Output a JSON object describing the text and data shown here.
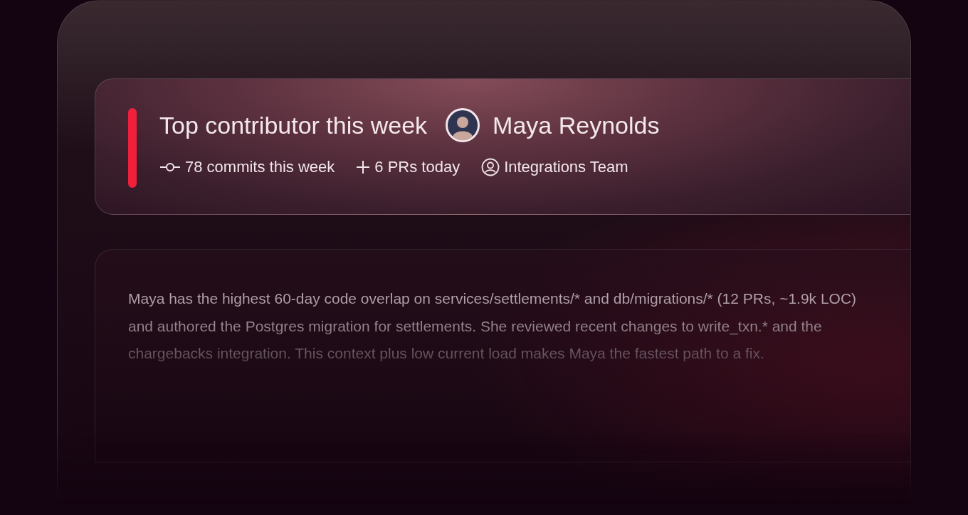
{
  "contributor": {
    "heading": "Top contributor this week",
    "name": "Maya Reynolds",
    "stats": [
      {
        "kind": "commits",
        "text": "78 commits this week"
      },
      {
        "kind": "prs",
        "text": "6 PRs today"
      },
      {
        "kind": "team",
        "text": "Integrations Team"
      }
    ]
  },
  "explanation": "Maya has the highest 60-day code overlap on services/settlements/* and db/migrations/* (12 PRs, ~1.9k LOC) and authored the Postgres migration for settlements. She reviewed recent changes to write_txn.* and the chargebacks integration. This context plus low current load makes Maya the fastest path to a fix."
}
